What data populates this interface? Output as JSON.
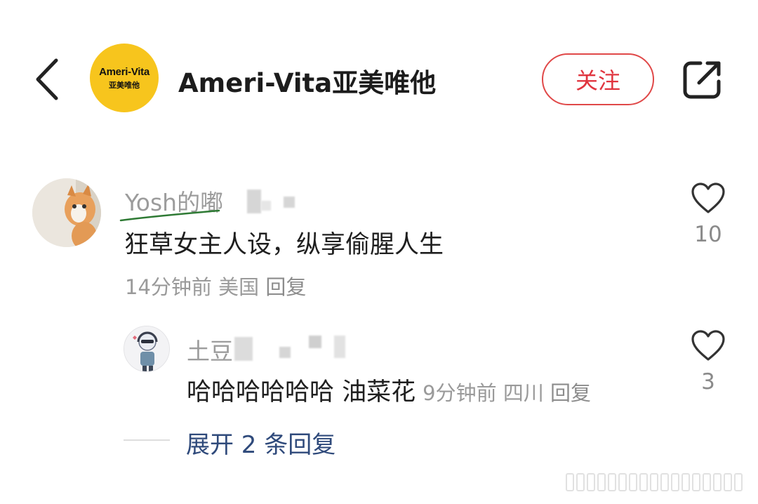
{
  "header": {
    "logo_text_en": "Ameri-Vita",
    "logo_text_cn": "亚美唯他",
    "brand_name": "Ameri-Vita亚美唯他",
    "follow_label": "关注"
  },
  "comments": [
    {
      "username": "Yosh的嘟",
      "text": "狂草女主人设，纵享偷腥人生",
      "time": "14分钟前",
      "location": "美国",
      "reply_label": "回复",
      "likes": "10"
    }
  ],
  "replies": [
    {
      "username": "土豆",
      "text": "哈哈哈哈哈哈 油菜花",
      "time": "9分钟前",
      "location": "四川",
      "reply_label": "回复",
      "likes": "3"
    }
  ],
  "expand_label": "展开 2 条回复",
  "colors": {
    "accent_red": "#e0343e",
    "logo_yellow": "#f7c51d",
    "link_blue": "#2f4a7b",
    "meta_gray": "#9a9a9a"
  }
}
